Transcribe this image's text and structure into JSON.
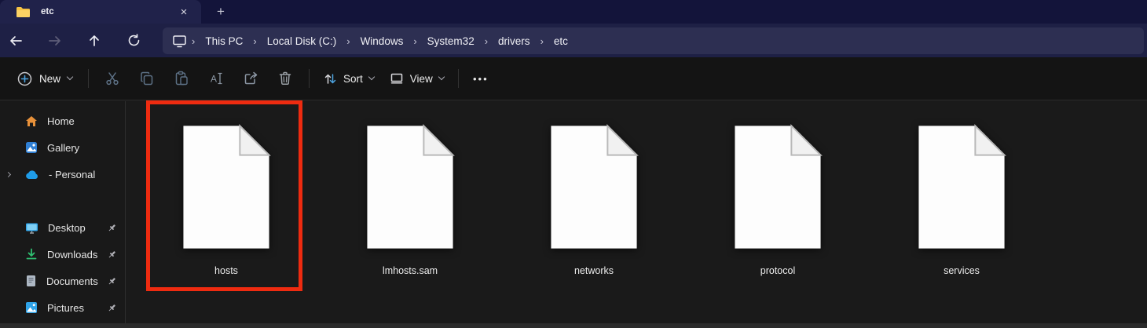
{
  "tab_bar": {
    "active_tab": "etc",
    "close_glyph": "×",
    "new_tab_glyph": "+"
  },
  "navigation": {
    "separator": "›",
    "breadcrumb": [
      "This PC",
      "Local Disk (C:)",
      "Windows",
      "System32",
      "drivers",
      "etc"
    ]
  },
  "toolbar": {
    "new_label": "New",
    "sort_label": "Sort",
    "view_label": "View",
    "more_glyph": "•••",
    "icon_buttons": [
      "cut",
      "copy",
      "paste",
      "rename",
      "share",
      "delete"
    ]
  },
  "sidebar": {
    "home": "Home",
    "gallery": "Gallery",
    "onedrive": "- Personal",
    "desktop": "Desktop",
    "downloads": "Downloads",
    "documents": "Documents",
    "pictures": "Pictures"
  },
  "files": [
    {
      "name": "hosts",
      "highlighted": true
    },
    {
      "name": "lmhosts.sam",
      "highlighted": false
    },
    {
      "name": "networks",
      "highlighted": false
    },
    {
      "name": "protocol",
      "highlighted": false
    },
    {
      "name": "services",
      "highlighted": false
    }
  ],
  "colors": {
    "highlight_box": "#ee2b10",
    "titlebar_navy": "#1e2045",
    "breadcrumb_bar": "#2d2f52",
    "accent_blue": "#4da3e0",
    "onedrive_blue": "#1f9ce8",
    "downloads_green": "#2fbf71",
    "home_orange": "#e8913a",
    "folder_yellow": "#f5c244"
  }
}
